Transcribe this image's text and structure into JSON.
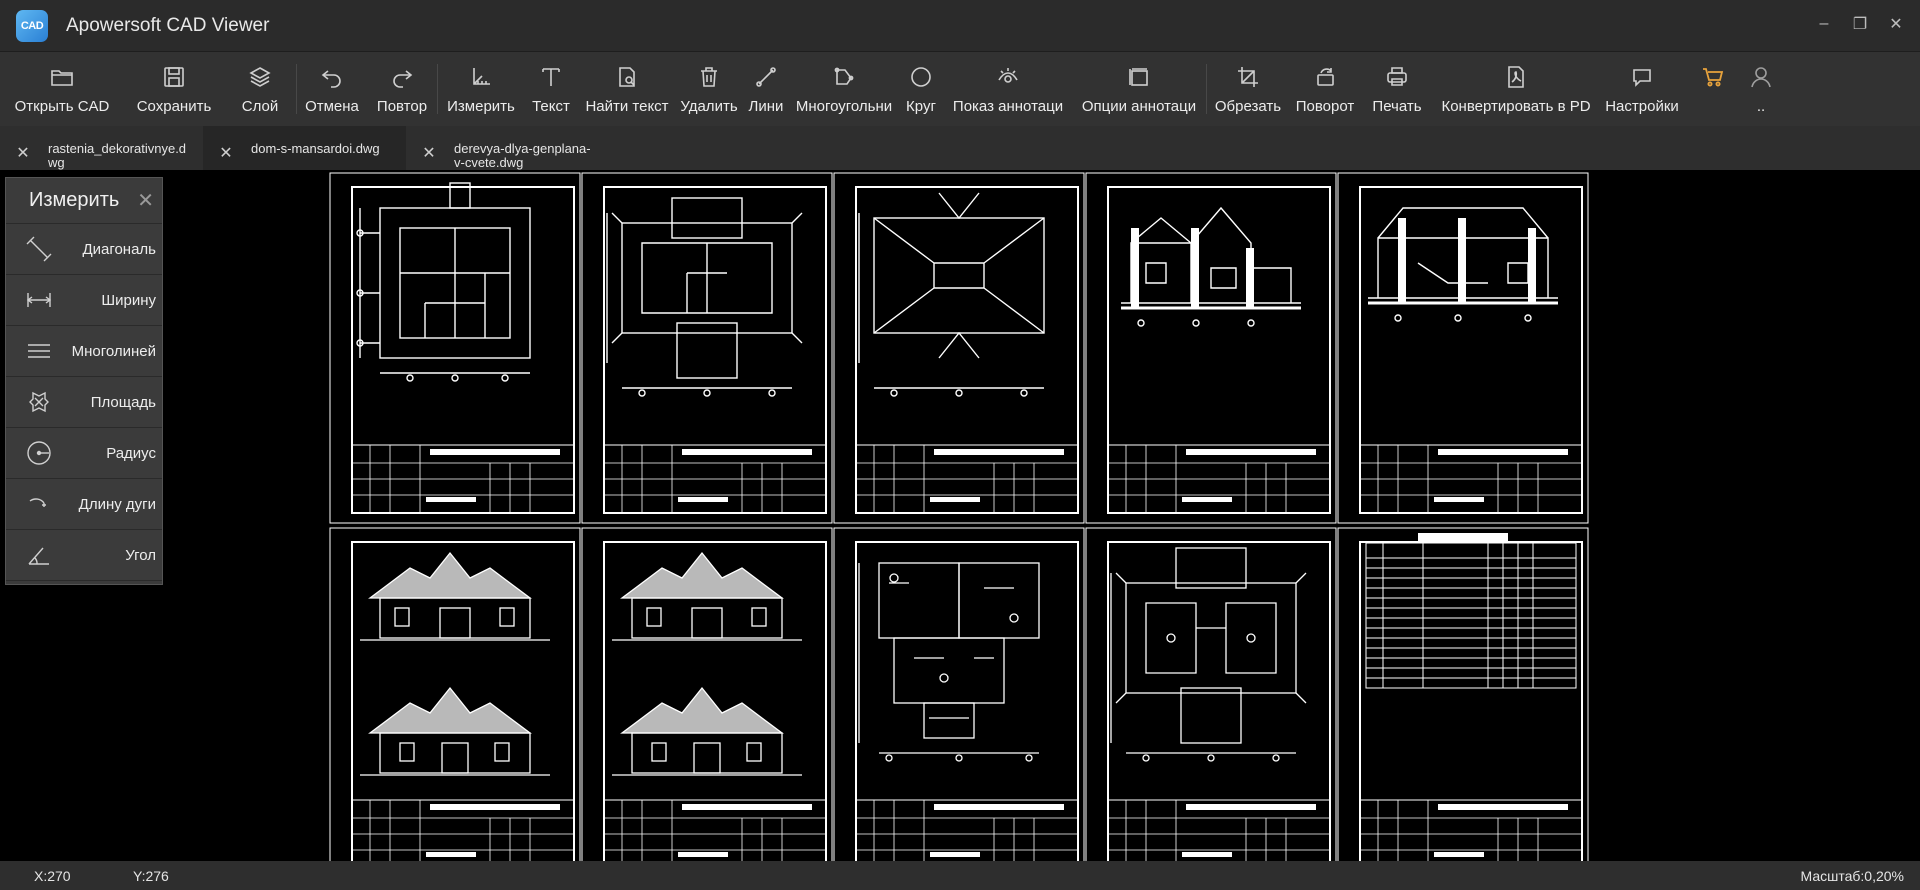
{
  "window": {
    "title": "Apowersoft CAD Viewer",
    "logo_text": "CAD",
    "controls": {
      "minimize": "–",
      "restore": "❐",
      "close": "✕"
    }
  },
  "toolbar": {
    "items": [
      {
        "label": "Открыть CAD",
        "icon": "folder-icon"
      },
      {
        "label": "Сохранить",
        "icon": "save-icon"
      },
      {
        "label": "Слой",
        "icon": "layers-icon"
      },
      {
        "label": "Отмена",
        "icon": "undo-icon"
      },
      {
        "label": "Повтор",
        "icon": "redo-icon"
      },
      {
        "label": "Измерить",
        "icon": "measure-icon"
      },
      {
        "label": "Текст",
        "icon": "text-icon"
      },
      {
        "label": "Найти текст",
        "icon": "find-text-icon"
      },
      {
        "label": "Удалить",
        "icon": "trash-icon"
      },
      {
        "label": "Лини",
        "icon": "line-icon"
      },
      {
        "label": "Многоугольни",
        "icon": "polygon-icon"
      },
      {
        "label": "Круг",
        "icon": "circle-icon"
      },
      {
        "label": "Показ аннотаци",
        "icon": "show-annotation-icon"
      },
      {
        "label": "Опции аннотаци",
        "icon": "annotation-options-icon"
      },
      {
        "label": "Обрезать",
        "icon": "crop-icon"
      },
      {
        "label": "Поворот",
        "icon": "rotate-icon"
      },
      {
        "label": "Печать",
        "icon": "print-icon"
      },
      {
        "label": "Конвертировать в PD",
        "icon": "pdf-icon"
      },
      {
        "label": "Настройки",
        "icon": "settings-icon"
      },
      {
        "label": "",
        "icon": "cart-icon"
      },
      {
        "label": "..",
        "icon": "user-icon"
      }
    ]
  },
  "tabs": [
    {
      "name": "rastenia_dekorativnye.dwg",
      "active": false
    },
    {
      "name": "dom-s-mansardoi.dwg",
      "active": true
    },
    {
      "name": "derevya-dlya-genplana-v-cvete.dwg",
      "active": false
    }
  ],
  "tab_close_glyph": "✕",
  "measure_panel": {
    "title": "Измерить",
    "close_glyph": "✕",
    "items": [
      {
        "label": "Диагональ",
        "icon": "diagonal-icon"
      },
      {
        "label": "Ширину",
        "icon": "width-icon"
      },
      {
        "label": "Многолиней",
        "icon": "polyline-icon"
      },
      {
        "label": "Площадь",
        "icon": "area-icon"
      },
      {
        "label": "Радиус",
        "icon": "radius-icon"
      },
      {
        "label": "Длину дуги",
        "icon": "arc-length-icon"
      },
      {
        "label": "Угол",
        "icon": "angle-icon"
      }
    ]
  },
  "status": {
    "x": "X:270",
    "y": "Y:276",
    "scale": "Масштаб:0,20%"
  },
  "colors": {
    "background": "#000000",
    "chrome": "#323232",
    "accent_cart": "#e8a33c",
    "drawing_lines": "#ffffff"
  }
}
